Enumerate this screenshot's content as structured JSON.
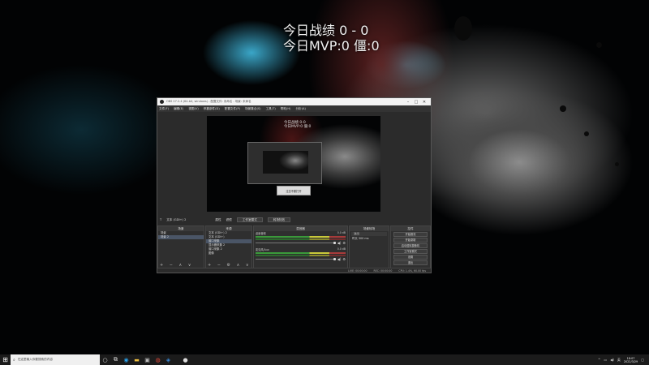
{
  "overlay": {
    "line1": "今日战绩  0 - 0",
    "line2": "今日MVP:0 僵:0"
  },
  "obs": {
    "window_title": "OBS 27.2.4 (64-bit, windows) - 配置文件: 未命名 - 场景: 未命名",
    "controls": {
      "minimize": "–",
      "maximize": "□",
      "close": "✕"
    },
    "menu": [
      "文件(F)",
      "编辑(E)",
      "视图(V)",
      "停靠部件(D)",
      "配置文件(P)",
      "场景集合(S)",
      "工具(T)",
      "帮助(H)",
      "分析(A)"
    ],
    "preview_text": [
      "今日战绩 0-0",
      "今日MVP:0 僵:0"
    ],
    "nested_dialog": "注意不断打开",
    "toolbar": {
      "source_label": "文本 (GDI+) 2",
      "properties": "属性",
      "filters": "滤镜",
      "studio": "工作室模式",
      "transitions": "转场特效"
    },
    "docks": {
      "scenes": {
        "title": "场景",
        "items": [
          "场景",
          "场景 2"
        ]
      },
      "sources": {
        "title": "来源",
        "items": [
          "文本 (GDI+) 2",
          "文本 (GDI+)",
          "窗口采集",
          "显示器采集 2",
          "窗口采集 2",
          "图像"
        ]
      },
      "mixer": {
        "title": "混音器",
        "channels": [
          {
            "name": "桌面音频",
            "db": "0.0 dB"
          },
          {
            "name": "麦克风/Aux",
            "db": "0.0 dB"
          }
        ]
      },
      "transitions": {
        "title": "场景转场",
        "type": "淡出",
        "duration_label": "时长",
        "duration": "300 ms"
      },
      "controls": {
        "title": "控件",
        "buttons": [
          "开始推流",
          "开始录制",
          "启动虚拟摄像机",
          "工作室模式",
          "设置",
          "退出"
        ]
      }
    },
    "status": [
      "LIVE: 00:00:00",
      "REC: 00:00:00",
      "CPU: 1.4%, 60.00 fps"
    ]
  },
  "taskbar": {
    "search_placeholder": "在这里输入你要搜索的内容",
    "clock_time": "18:07",
    "clock_date": "2022/3/29",
    "colors": {
      "taskbar": "#1b1b1b",
      "search": "#f0f0f0"
    }
  }
}
